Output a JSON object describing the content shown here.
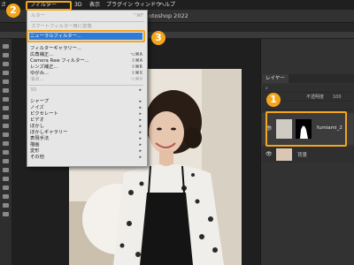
{
  "menubar": {
    "app_fragment": "さ",
    "items": [
      "フィルター",
      "3D",
      "表示",
      "プラグイン",
      "ウィンドウ",
      "ヘルプ"
    ]
  },
  "document": {
    "title_fragment": "otoshop 2022"
  },
  "filter_menu": {
    "last_filter": {
      "label": "ルター",
      "shortcut": "^⌘F"
    },
    "convert_smart": {
      "label": "スマートフィルター用に変換"
    },
    "items": [
      {
        "label": "ニューラルフィルター...",
        "shortcut": "",
        "submenu": false,
        "dim": false,
        "highlighted": true
      },
      {
        "label": "フィルターギャラリー...",
        "shortcut": "",
        "submenu": false,
        "dim": false
      },
      {
        "label": "広角補正...",
        "shortcut": "⌥⌘A",
        "submenu": false,
        "dim": false
      },
      {
        "label": "Camera Raw フィルター...",
        "shortcut": "⇧⌘A",
        "submenu": false,
        "dim": false
      },
      {
        "label": "レンズ補正...",
        "shortcut": "⇧⌘R",
        "submenu": false,
        "dim": false
      },
      {
        "label": "ゆがみ...",
        "shortcut": "⇧⌘X",
        "submenu": false,
        "dim": false
      },
      {
        "label": "消点...",
        "shortcut": "⌥⌘V",
        "submenu": false,
        "dim": true
      },
      {
        "label": "3D",
        "shortcut": "",
        "submenu": true,
        "dim": true
      },
      {
        "label": "シャープ",
        "shortcut": "",
        "submenu": true,
        "dim": false
      },
      {
        "label": "ノイズ",
        "shortcut": "",
        "submenu": true,
        "dim": false
      },
      {
        "label": "ピクセレート",
        "shortcut": "",
        "submenu": true,
        "dim": false
      },
      {
        "label": "ビデオ",
        "shortcut": "",
        "submenu": true,
        "dim": false
      },
      {
        "label": "ぼかし",
        "shortcut": "",
        "submenu": true,
        "dim": false
      },
      {
        "label": "ぼかしギャラリー",
        "shortcut": "",
        "submenu": true,
        "dim": false
      },
      {
        "label": "表現手法",
        "shortcut": "",
        "submenu": true,
        "dim": false
      },
      {
        "label": "描画",
        "shortcut": "",
        "submenu": true,
        "dim": false
      },
      {
        "label": "変形",
        "shortcut": "",
        "submenu": true,
        "dim": false
      },
      {
        "label": "その他",
        "shortcut": "",
        "submenu": true,
        "dim": false
      }
    ]
  },
  "layers_panel": {
    "tab_label": "レイヤー",
    "opacity_label": "不透明度",
    "opacity_value": "100",
    "layers": [
      {
        "name": "fumiami_2",
        "selected": true
      },
      {
        "name": "背景",
        "selected": false
      }
    ]
  },
  "annotations": {
    "step1": "1",
    "step2": "2",
    "step3": "3"
  },
  "colors": {
    "accent": "#f4a51c",
    "highlight": "#2e7bd7"
  }
}
